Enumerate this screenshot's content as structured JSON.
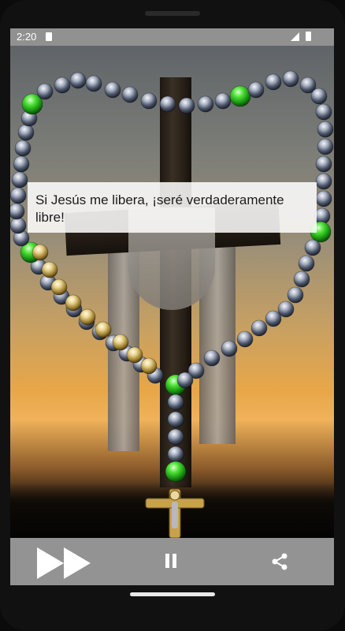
{
  "status_bar": {
    "time": "2:20",
    "icons": [
      "sd-card-icon",
      "signal-icon",
      "battery-icon"
    ]
  },
  "prayer_text": "Si Jesús me libera, ¡seré verdaderamente libre!",
  "rosary": {
    "counts": {
      "silver": 53,
      "green": 6,
      "gold": 9
    }
  },
  "controls": {
    "icons": {
      "next": "fast-forward-icon",
      "pause": "pause-icon",
      "share": "share-icon"
    }
  },
  "colors": {
    "status_bar": "#a9a9a9",
    "bottom_bar": "#a0a0a0",
    "green_bead": "#22b51a",
    "gold_bead": "#c8a74a",
    "silver_bead": "#8a93a6",
    "text": "#1b1b1b"
  }
}
